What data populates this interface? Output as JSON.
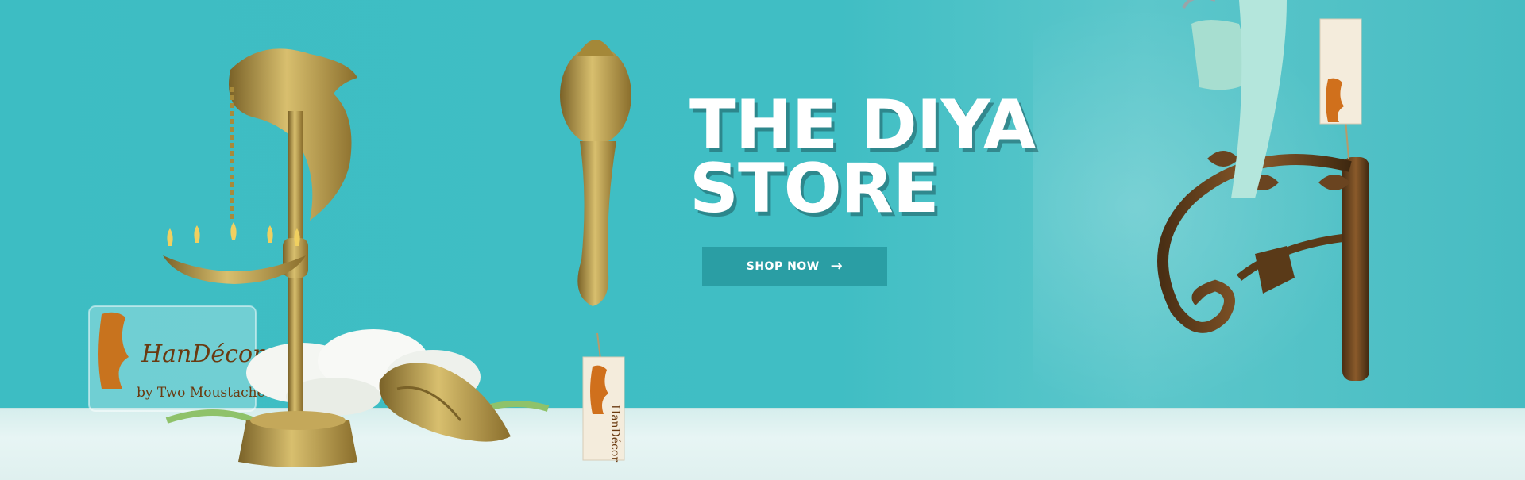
{
  "hero": {
    "headline_line1": "THE DIYA",
    "headline_line2": "STORE",
    "cta_label": "SHOP NOW",
    "cta_icon": "arrow-right-icon"
  },
  "brand": {
    "name": "HanDécor",
    "tagline": "by Two Moustaches"
  },
  "colors": {
    "wall": "#3fbdc3",
    "shelf": "#e2f3f2",
    "cta_bg": "#2a9ea4",
    "cta_text": "#ffffff",
    "brass": "#b89a4a",
    "tag_orange": "#d0701c"
  }
}
